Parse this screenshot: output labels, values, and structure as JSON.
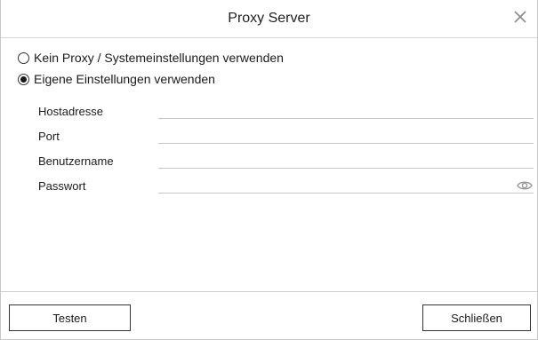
{
  "dialog": {
    "title": "Proxy Server",
    "close_icon": "close-icon"
  },
  "proxy_mode": {
    "options": [
      {
        "label": "Kein Proxy / Systemeinstellungen verwenden",
        "selected": false
      },
      {
        "label": "Eigene Einstellungen verwenden",
        "selected": true
      }
    ]
  },
  "fields": {
    "host": {
      "label": "Hostadresse",
      "value": ""
    },
    "port": {
      "label": "Port",
      "value": ""
    },
    "username": {
      "label": "Benutzername",
      "value": ""
    },
    "password": {
      "label": "Passwort",
      "value": "",
      "reveal_icon": "eye-icon"
    }
  },
  "buttons": {
    "test_label": "Testen",
    "close_label": "Schließen"
  },
  "colors": {
    "border": "#c8c8c8",
    "field_underline": "#c6c6c6",
    "text": "#1a1a1a",
    "icon": "#9a9a9a"
  }
}
